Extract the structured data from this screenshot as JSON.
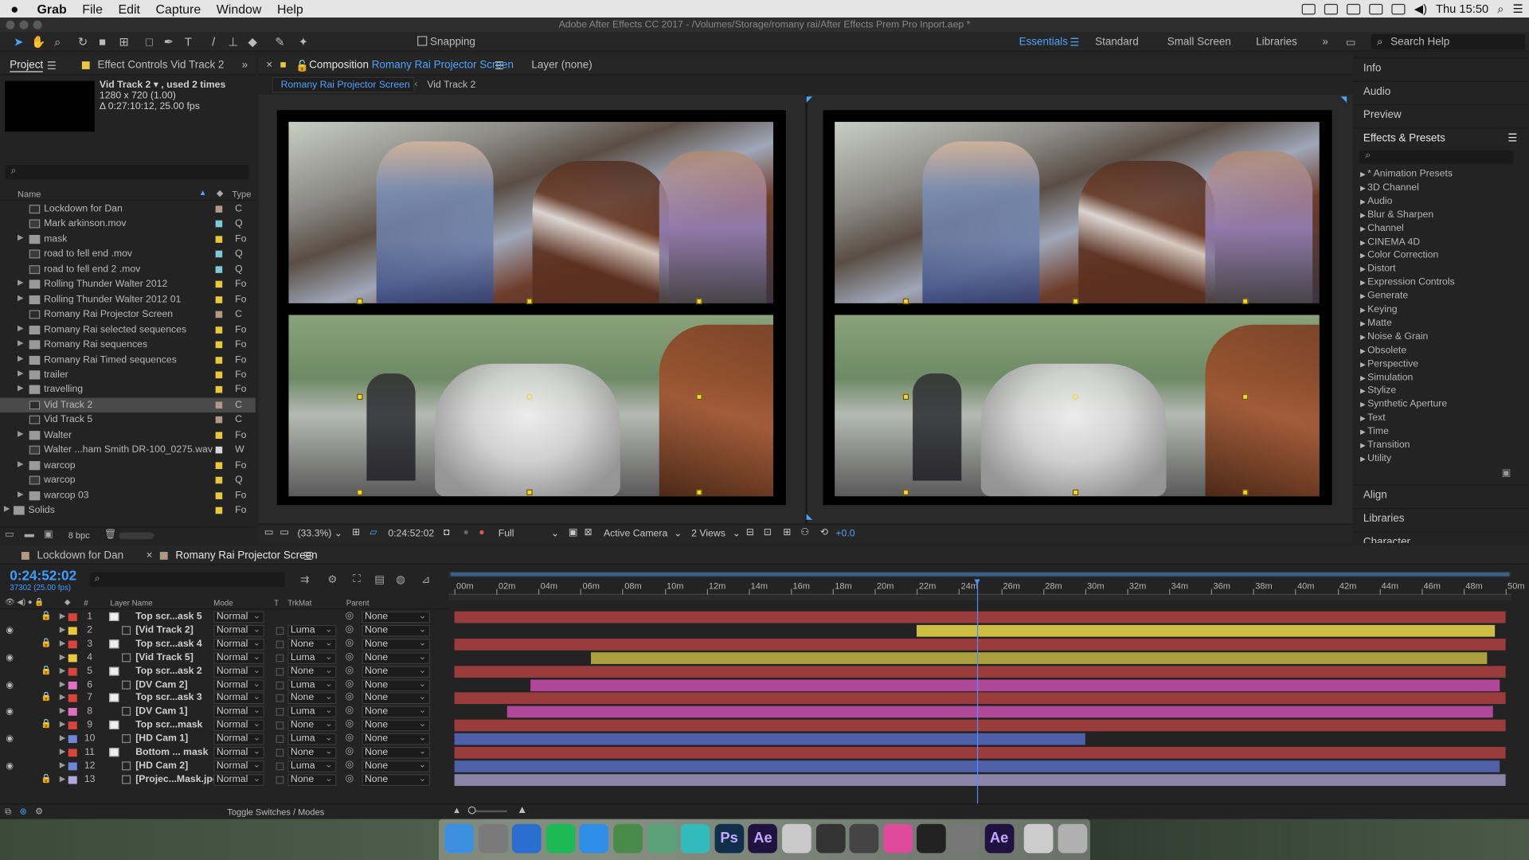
{
  "menubar": {
    "app": "Grab",
    "items": [
      "File",
      "Edit",
      "Capture",
      "Window",
      "Help"
    ],
    "clock": "Thu 15:50"
  },
  "window": {
    "title": "Adobe After Effects CC 2017 - /Volumes/Storage/romany rai/After Effects Prem Pro Inport.aep *"
  },
  "toolbar": {
    "snapping": "Snapping",
    "workspaces": [
      "Essentials",
      "Standard",
      "Small Screen",
      "Libraries"
    ],
    "active_workspace": "Essentials",
    "search_placeholder": "Search Help"
  },
  "project": {
    "tabs": [
      "Project",
      "Effect Controls Vid Track 2"
    ],
    "info": {
      "name": "Vid Track 2 ▾ , used 2 times",
      "size": "1280 x 720 (1.00)",
      "duration": "Δ 0:27:10:12, 25.00 fps"
    },
    "columns": {
      "name": "Name",
      "type": "Type"
    },
    "bpc": "8 bpc",
    "items": [
      {
        "name": "Lockdown for Dan",
        "kind": "comp",
        "label": "#b09a86",
        "type": "C"
      },
      {
        "name": "Mark arkinson.mov",
        "kind": "file",
        "label": "#7fc9d8",
        "type": "Q"
      },
      {
        "name": "mask",
        "kind": "folder",
        "label": "#e8c83c",
        "type": "Fo"
      },
      {
        "name": "road to fell end .mov",
        "kind": "file",
        "label": "#7fc9d8",
        "type": "Q"
      },
      {
        "name": "road to fell end 2 .mov",
        "kind": "file",
        "label": "#7fc9d8",
        "type": "Q"
      },
      {
        "name": "Rolling Thunder Walter 2012",
        "kind": "folder",
        "label": "#e8c83c",
        "type": "Fo"
      },
      {
        "name": "Rolling Thunder Walter 2012 01",
        "kind": "folder",
        "label": "#e8c83c",
        "type": "Fo"
      },
      {
        "name": "Romany Rai Projector Screen",
        "kind": "comp",
        "label": "#b09a86",
        "type": "C"
      },
      {
        "name": "Romany Rai selected sequences",
        "kind": "folder",
        "label": "#e8c83c",
        "type": "Fo"
      },
      {
        "name": "Romany Rai sequences",
        "kind": "folder",
        "label": "#e8c83c",
        "type": "Fo"
      },
      {
        "name": "Romany Rai Timed sequences",
        "kind": "folder",
        "label": "#e8c83c",
        "type": "Fo"
      },
      {
        "name": "trailer",
        "kind": "folder",
        "label": "#e8c83c",
        "type": "Fo"
      },
      {
        "name": "travelling",
        "kind": "folder",
        "label": "#e8c83c",
        "type": "Fo"
      },
      {
        "name": "Vid Track 2",
        "kind": "comp",
        "label": "#b09a86",
        "type": "C"
      },
      {
        "name": "Vid Track 5",
        "kind": "comp",
        "label": "#b09a86",
        "type": "C"
      },
      {
        "name": "Walter",
        "kind": "folder",
        "label": "#e8c83c",
        "type": "Fo"
      },
      {
        "name": "Walter ...ham Smith DR-100_0275.wav",
        "kind": "file",
        "label": "#d8d8d8",
        "type": "W"
      },
      {
        "name": "warcop",
        "kind": "folder",
        "label": "#e8c83c",
        "type": "Fo"
      },
      {
        "name": "warcop",
        "kind": "file",
        "label": "#e8c83c",
        "type": "Q"
      },
      {
        "name": "warcop 03",
        "kind": "folder",
        "label": "#e8c83c",
        "type": "Fo"
      },
      {
        "name": "Solids",
        "kind": "folder",
        "label": "#e8c83c",
        "type": "Fo"
      }
    ]
  },
  "comp": {
    "tab_prefix": "Composition",
    "comp_name": "Romany Rai Projector Screen",
    "layer_tab": "Layer (none)",
    "breadcrumb": [
      "Romany Rai Projector Screen",
      "Vid Track 2"
    ],
    "footer": {
      "zoom": "(33.3%)",
      "timecode": "0:24:52:02",
      "resolution": "Full",
      "camera": "Active Camera",
      "views": "2 Views",
      "exposure": "+0.0"
    }
  },
  "right": {
    "sections_top": [
      "Info",
      "Audio",
      "Preview"
    ],
    "effects_title": "Effects & Presets",
    "effects": [
      "* Animation Presets",
      "3D Channel",
      "Audio",
      "Blur & Sharpen",
      "Channel",
      "CINEMA 4D",
      "Color Correction",
      "Distort",
      "Expression Controls",
      "Generate",
      "Keying",
      "Matte",
      "Noise & Grain",
      "Obsolete",
      "Perspective",
      "Simulation",
      "Stylize",
      "Synthetic Aperture",
      "Text",
      "Time",
      "Transition",
      "Utility"
    ],
    "sections_bottom": [
      "Align",
      "Libraries",
      "Character"
    ]
  },
  "timeline": {
    "tabs": [
      "Lockdown for Dan",
      "Romany Rai Projector Screen"
    ],
    "timecode": "0:24:52:02",
    "frames": "37302 (25.00 fps)",
    "columns": {
      "name": "Layer Name",
      "mode": "Mode",
      "t": "T",
      "trkmat": "TrkMat",
      "parent": "Parent"
    },
    "ruler": [
      "00m",
      "02m",
      "04m",
      "06m",
      "08m",
      "10m",
      "12m",
      "14m",
      "16m",
      "18m",
      "20m",
      "22m",
      "24m",
      "26m",
      "28m",
      "30m",
      "32m",
      "34m",
      "36m",
      "38m",
      "40m",
      "42m",
      "44m",
      "46m",
      "48m",
      "50m"
    ],
    "duration_minutes": 50,
    "playhead_minutes": 24.87,
    "toggle_label": "Toggle Switches / Modes",
    "layers": [
      {
        "n": "1",
        "name": "Top scr...ask 5",
        "mode": "Normal",
        "trkmat": "",
        "parent": "None",
        "label": "#d9453a",
        "kind": "solid",
        "eye": false,
        "lock": true,
        "bar": "#9a3c3c",
        "start": 0,
        "end": 50
      },
      {
        "n": "2",
        "name": "[Vid Track 2]",
        "mode": "Normal",
        "trkmat": "Luma",
        "parent": "None",
        "label": "#e8c83c",
        "kind": "comp",
        "eye": true,
        "lock": false,
        "bar": "#cdbd44",
        "start": 22,
        "end": 49.5
      },
      {
        "n": "3",
        "name": "Top scr...ask 4",
        "mode": "Normal",
        "trkmat": "None",
        "parent": "None",
        "label": "#d9453a",
        "kind": "solid",
        "eye": false,
        "lock": true,
        "bar": "#9a3c3c",
        "start": 0,
        "end": 50
      },
      {
        "n": "4",
        "name": "[Vid Track 5]",
        "mode": "Normal",
        "trkmat": "Luma",
        "parent": "None",
        "label": "#e8c83c",
        "kind": "comp",
        "eye": true,
        "lock": false,
        "bar": "#aaa03e",
        "start": 6.5,
        "end": 49.1
      },
      {
        "n": "5",
        "name": "Top scr...ask 2",
        "mode": "Normal",
        "trkmat": "None",
        "parent": "None",
        "label": "#d9453a",
        "kind": "solid",
        "eye": false,
        "lock": true,
        "bar": "#9a3c3c",
        "start": 0,
        "end": 50
      },
      {
        "n": "6",
        "name": "[DV Cam 2]",
        "mode": "Normal",
        "trkmat": "Luma",
        "parent": "None",
        "label": "#e070c0",
        "kind": "comp",
        "eye": true,
        "lock": false,
        "bar": "#b0489a",
        "start": 3.6,
        "end": 49.7
      },
      {
        "n": "7",
        "name": "Top scr...ask 3",
        "mode": "Normal",
        "trkmat": "None",
        "parent": "None",
        "label": "#d9453a",
        "kind": "solid",
        "eye": false,
        "lock": true,
        "bar": "#9a3c3c",
        "start": 0,
        "end": 50
      },
      {
        "n": "8",
        "name": "[DV Cam 1]",
        "mode": "Normal",
        "trkmat": "Luma",
        "parent": "None",
        "label": "#e070c0",
        "kind": "comp",
        "eye": true,
        "lock": false,
        "bar": "#b0489a",
        "start": 2.5,
        "end": 49.4
      },
      {
        "n": "9",
        "name": "Top scr...mask",
        "mode": "Normal",
        "trkmat": "None",
        "parent": "None",
        "label": "#d9453a",
        "kind": "solid",
        "eye": false,
        "lock": true,
        "bar": "#9a3c3c",
        "start": 0,
        "end": 50
      },
      {
        "n": "10",
        "name": "[HD Cam 1]",
        "mode": "Normal",
        "trkmat": "Luma",
        "parent": "None",
        "label": "#6f86d8",
        "kind": "comp",
        "eye": true,
        "lock": false,
        "bar": "#5060a8",
        "start": 0,
        "end": 30
      },
      {
        "n": "11",
        "name": "Bottom ... mask",
        "mode": "Normal",
        "trkmat": "None",
        "parent": "None",
        "label": "#d9453a",
        "kind": "solid",
        "eye": false,
        "lock": false,
        "bar": "#9a3c3c",
        "start": 0,
        "end": 50
      },
      {
        "n": "12",
        "name": "[HD Cam 2]",
        "mode": "Normal",
        "trkmat": "Luma",
        "parent": "None",
        "label": "#6f86d8",
        "kind": "comp",
        "eye": true,
        "lock": false,
        "bar": "#5060a8",
        "start": 0,
        "end": 49.7
      },
      {
        "n": "13",
        "name": "[Projec...Mask.jpg]",
        "mode": "Normal",
        "trkmat": "None",
        "parent": "None",
        "label": "#b2a8d8",
        "kind": "file",
        "eye": false,
        "lock": true,
        "bar": "#8a84a8",
        "start": 0,
        "end": 50
      }
    ]
  },
  "dock": {
    "apps": [
      {
        "name": "Finder",
        "letter": "",
        "color": "#3d8fe0"
      },
      {
        "name": "Launchpad",
        "letter": "",
        "color": "#7a7a7a"
      },
      {
        "name": "Xcode",
        "letter": "",
        "color": "#2a6fd0"
      },
      {
        "name": "Spotify",
        "letter": "",
        "color": "#1db954"
      },
      {
        "name": "Safari",
        "letter": "",
        "color": "#2f8ee8"
      },
      {
        "name": "Globe",
        "letter": "",
        "color": "#4a8a4a"
      },
      {
        "name": "Maps",
        "letter": "",
        "color": "#5aa37a"
      },
      {
        "name": "Fetch",
        "letter": "",
        "color": "#33bbbb"
      },
      {
        "name": "Photoshop",
        "letter": "Ps",
        "color": "#0f2f4a"
      },
      {
        "name": "After Effects",
        "letter": "Ae",
        "color": "#1f1140"
      },
      {
        "name": "Preview",
        "letter": "",
        "color": "#c9c9c9"
      },
      {
        "name": "Final Cut",
        "letter": "",
        "color": "#333333"
      },
      {
        "name": "Motion",
        "letter": "",
        "color": "#444444"
      },
      {
        "name": "iTunes",
        "letter": "",
        "color": "#e04a9a"
      },
      {
        "name": "Terminal",
        "letter": "",
        "color": "#222222"
      },
      {
        "name": "System Preferences",
        "letter": "",
        "color": "#777777"
      },
      {
        "name": "After Effects",
        "letter": "Ae",
        "color": "#1f1140"
      },
      {
        "name": "Documents",
        "letter": "",
        "color": "#cccccc"
      },
      {
        "name": "Trash",
        "letter": "",
        "color": "#b0b0b0"
      }
    ]
  },
  "colors": {
    "accent": "#4da3ff",
    "timecode": "#3f9dff",
    "selected_tab": "#4da3ff"
  }
}
